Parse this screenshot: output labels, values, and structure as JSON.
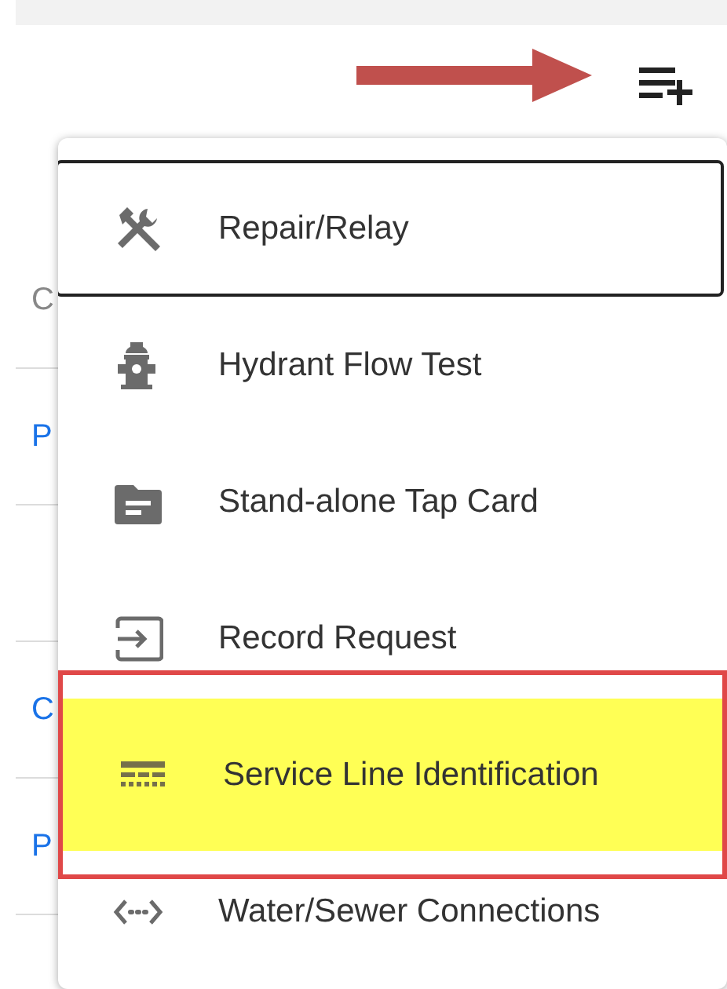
{
  "background_list": [
    {
      "text": "C",
      "kind": "label"
    },
    {
      "text": "P",
      "kind": "link"
    },
    {
      "kind": "blank"
    },
    {
      "text": "C",
      "kind": "link"
    },
    {
      "text": "P",
      "kind": "link"
    }
  ],
  "menu": {
    "items": [
      {
        "label": "Repair/Relay",
        "kind": "tools",
        "focused": true,
        "highlighted": false
      },
      {
        "label": "Hydrant Flow Test",
        "kind": "hydrant",
        "focused": false,
        "highlighted": false
      },
      {
        "label": "Stand-alone Tap Card",
        "kind": "folder",
        "focused": false,
        "highlighted": false
      },
      {
        "label": "Record Request",
        "kind": "input",
        "focused": false,
        "highlighted": false
      },
      {
        "label": "Service Line Identification",
        "kind": "service",
        "focused": false,
        "highlighted": true
      },
      {
        "label": "Water/Sewer Connections",
        "kind": "connections",
        "focused": false,
        "highlighted": false
      }
    ]
  }
}
